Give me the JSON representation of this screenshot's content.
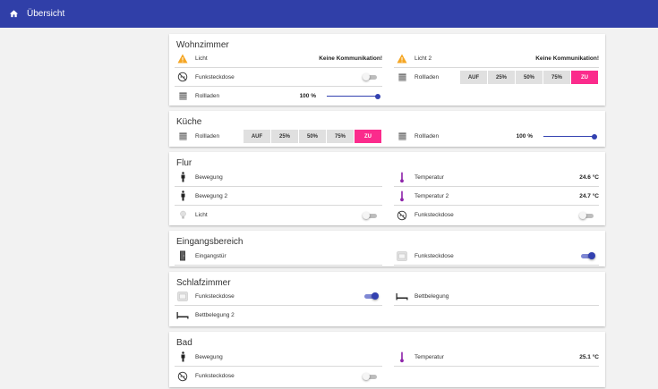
{
  "header": {
    "title": "Übersicht"
  },
  "rooms": {
    "wohnzimmer": {
      "title": "Wohnzimmer",
      "licht": {
        "label": "Licht",
        "value": "Keine Kommunikation!"
      },
      "licht2": {
        "label": "Licht 2",
        "value": "Keine Kommunikation!"
      },
      "funk": {
        "label": "Funksteckdose",
        "on": false
      },
      "roll_buttons": {
        "label": "Rollladen",
        "buttons": [
          "AUF",
          "25%",
          "50%",
          "75%",
          "ZU"
        ],
        "active": "ZU"
      },
      "roll_slider": {
        "label": "Rollladen",
        "value": "100 %",
        "level_percent": 100
      }
    },
    "kueche": {
      "title": "Küche",
      "roll_buttons": {
        "label": "Rollladen",
        "buttons": [
          "AUF",
          "25%",
          "50%",
          "75%",
          "ZU"
        ],
        "active": "ZU"
      },
      "roll_slider": {
        "label": "Rollladen",
        "value": "100 %",
        "level_percent": 100
      }
    },
    "flur": {
      "title": "Flur",
      "bewegung": {
        "label": "Bewegung"
      },
      "bewegung2": {
        "label": "Bewegung 2"
      },
      "licht": {
        "label": "Licht",
        "on": false
      },
      "temp": {
        "label": "Temperatur",
        "value": "24.6 °C"
      },
      "temp2": {
        "label": "Temperatur 2",
        "value": "24.7 °C"
      },
      "funk": {
        "label": "Funksteckdose",
        "on": false
      }
    },
    "eingang": {
      "title": "Eingangsbereich",
      "tuer": {
        "label": "Eingangstür"
      },
      "funk": {
        "label": "Funksteckdose",
        "on": true
      }
    },
    "schlaf": {
      "title": "Schlafzimmer",
      "funk": {
        "label": "Funksteckdose",
        "on": true
      },
      "bett": {
        "label": "Bettbelegung"
      },
      "bett2": {
        "label": "Bettbelegung 2"
      }
    },
    "bad": {
      "title": "Bad",
      "bewegung": {
        "label": "Bewegung"
      },
      "temp": {
        "label": "Temperatur",
        "value": "25.1 °C"
      },
      "funk": {
        "label": "Funksteckdose",
        "on": false
      }
    }
  },
  "colors": {
    "appbar": "#303fa8",
    "accent": "#3341b0",
    "active_button": "#fb2b8c",
    "warning": "#f5a623"
  },
  "icons": [
    "home-icon",
    "warning-icon",
    "socket-off-icon",
    "shutter-icon",
    "motion-icon",
    "thermometer-icon",
    "bulb-icon",
    "door-icon",
    "socket-icon",
    "bed-icon"
  ]
}
